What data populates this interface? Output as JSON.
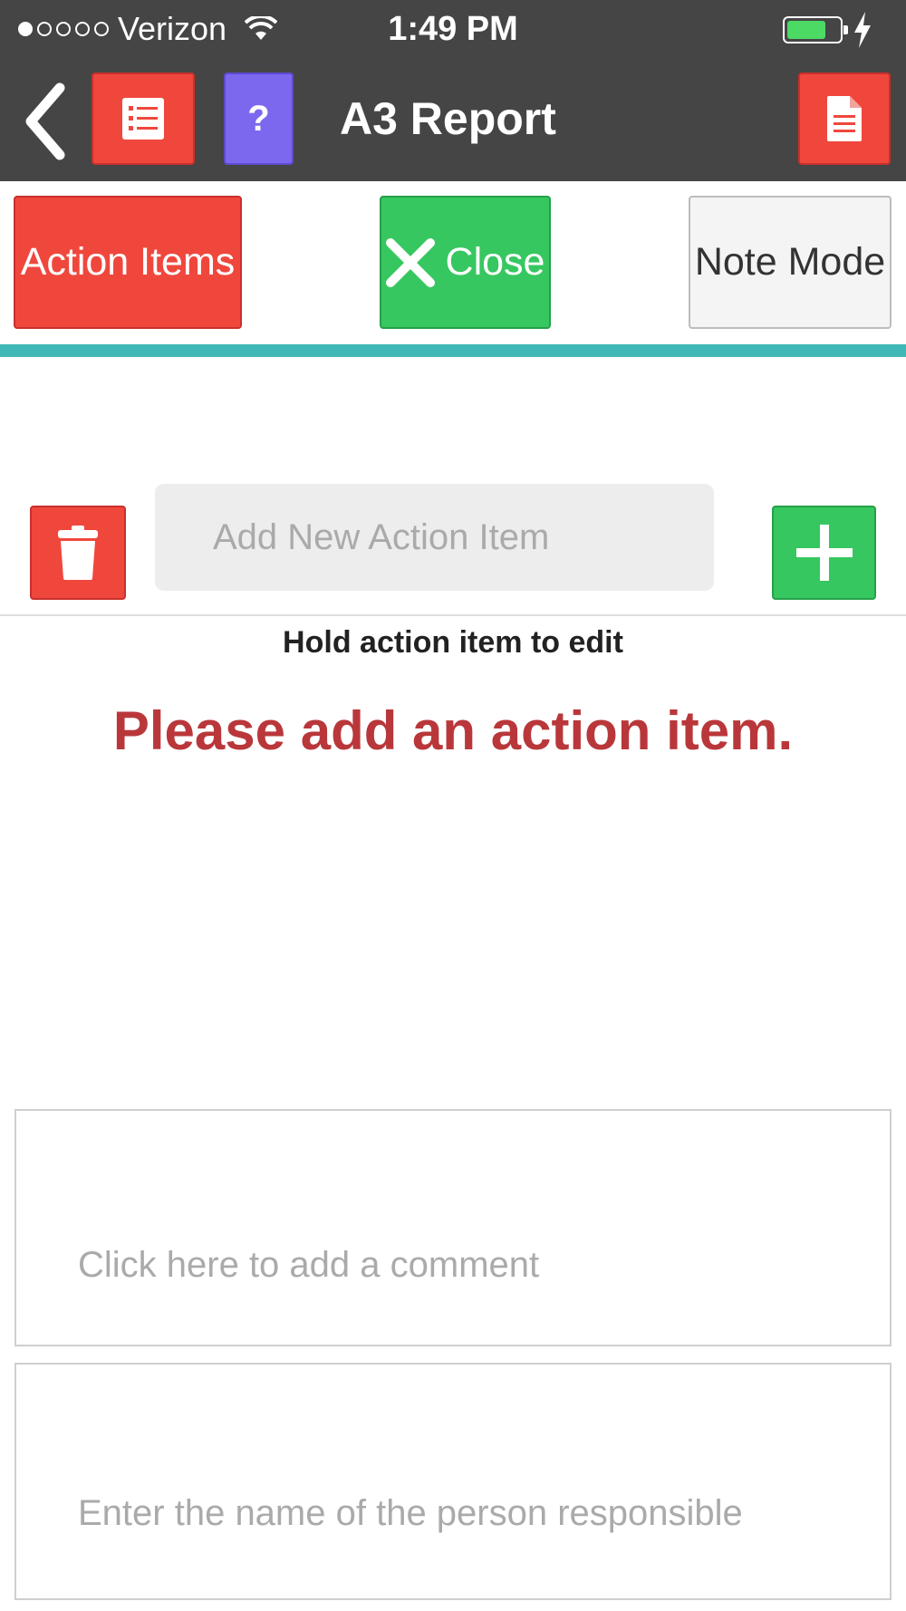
{
  "status_bar": {
    "carrier": "Verizon",
    "time": "1:49 PM",
    "signal_bars": 1,
    "signal_total": 5,
    "battery_level": 0.75
  },
  "nav": {
    "title": "A3 Report",
    "help_label": "?"
  },
  "toolbar": {
    "action_items_label": "Action Items",
    "close_label": "Close",
    "note_mode_label": "Note Mode"
  },
  "action_input": {
    "placeholder": "Add New Action Item",
    "value": ""
  },
  "hint": "Hold action item to edit",
  "empty_message": "Please add an action item.",
  "comment_box": {
    "placeholder": "Click here to add a comment"
  },
  "person_box": {
    "placeholder": "Enter the name of the person responsible"
  },
  "colors": {
    "red": "#f0473d",
    "green": "#37c760",
    "purple": "#7c68ee",
    "teal": "#3fb8b7",
    "message_red": "#b9373a",
    "nav_bg": "#454545"
  },
  "icons": [
    "back-chevron-icon",
    "list-icon",
    "help-icon",
    "document-icon",
    "close-x-icon",
    "trash-icon",
    "plus-icon",
    "wifi-icon",
    "battery-icon",
    "charging-bolt-icon"
  ]
}
